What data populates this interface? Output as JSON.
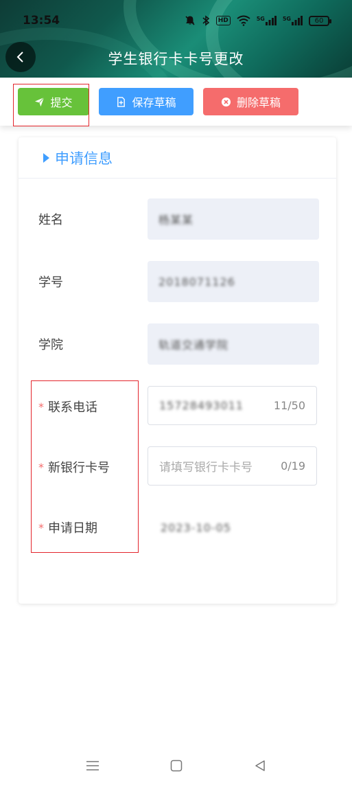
{
  "status_bar": {
    "time": "13:54",
    "network_1": "5G",
    "network_2": "5G",
    "hd_label": "HD",
    "battery": "60"
  },
  "header": {
    "title": "学生银行卡卡号更改"
  },
  "toolbar": {
    "submit_label": "提交",
    "save_label": "保存草稿",
    "delete_label": "删除草稿",
    "colors": {
      "submit": "#67c23a",
      "save": "#409eff",
      "delete": "#f56c6c"
    }
  },
  "form": {
    "section_title": "申请信息",
    "name": {
      "label": "姓名",
      "value": "杨某某"
    },
    "student_id": {
      "label": "学号",
      "value": "2018071126"
    },
    "college": {
      "label": "学院",
      "value": "轨道交通学院"
    },
    "phone": {
      "label": "联系电话",
      "required_mark": "*",
      "value": "15728493011",
      "counter": "11/50"
    },
    "bank_card": {
      "label": "新银行卡号",
      "required_mark": "*",
      "placeholder": "请填写银行卡卡号",
      "counter": "0/19"
    },
    "apply_date": {
      "label": "申请日期",
      "required_mark": "*",
      "value": "2023-10-05"
    }
  }
}
